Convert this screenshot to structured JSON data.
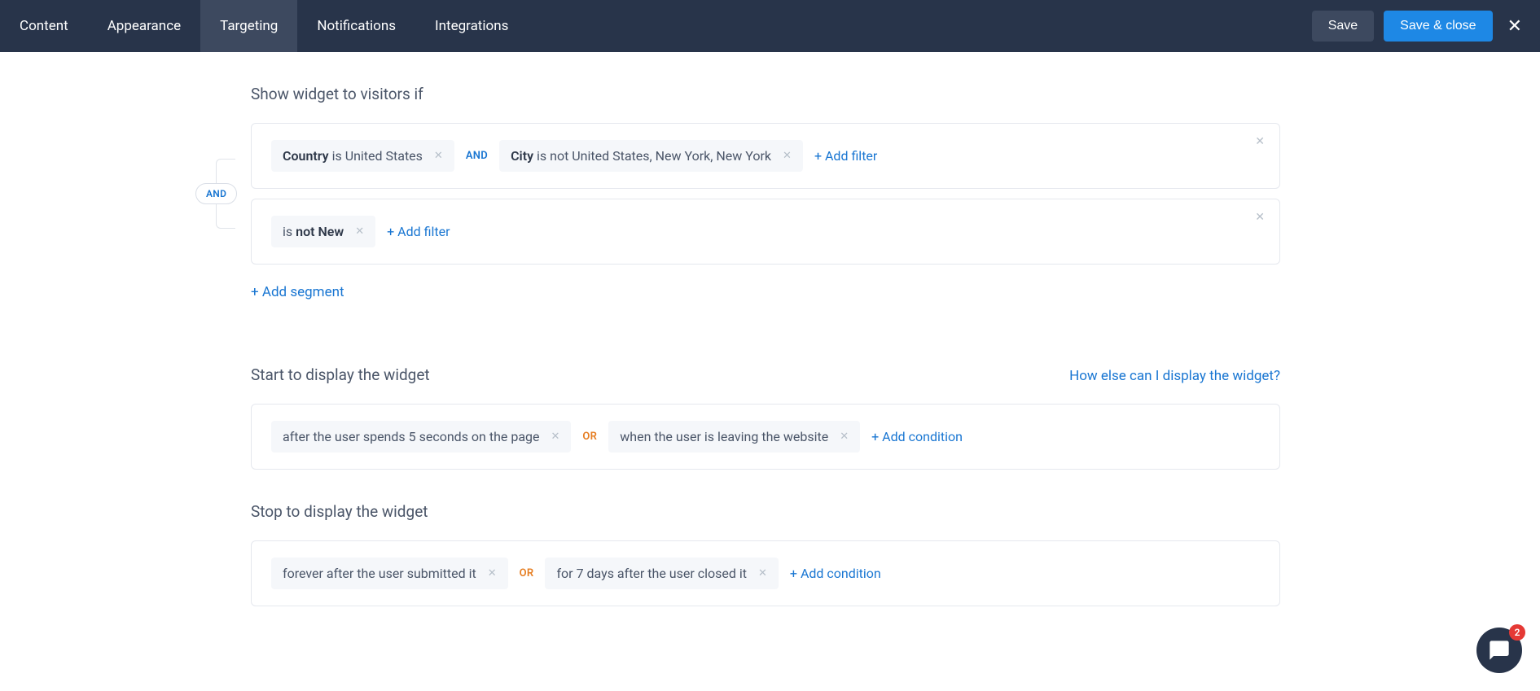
{
  "topbar": {
    "tabs": [
      "Content",
      "Appearance",
      "Targeting",
      "Notifications",
      "Integrations"
    ],
    "active_tab": "Targeting",
    "save_label": "Save",
    "save_close_label": "Save & close"
  },
  "show_widget": {
    "title": "Show widget to visitors if",
    "connector_label": "AND",
    "segments": [
      {
        "filters": [
          {
            "strong": "Country",
            "rest": " is United States"
          },
          {
            "strong": "City",
            "rest": " is not United States, New York, New York"
          }
        ],
        "join": "AND",
        "add_filter_label": "+ Add filter"
      },
      {
        "filters": [
          {
            "prefix": "is ",
            "strong": "not New",
            "rest": ""
          }
        ],
        "join": "",
        "add_filter_label": "+ Add filter"
      }
    ],
    "add_segment_label": "+ Add segment"
  },
  "start_display": {
    "title": "Start to display the widget",
    "help_label": "How else can I display the widget?",
    "conditions": [
      "after the user spends 5 seconds on the page",
      "when the user is leaving the website"
    ],
    "join": "OR",
    "add_label": "+ Add condition"
  },
  "stop_display": {
    "title": "Stop to display the widget",
    "conditions": [
      "forever after the user submitted it",
      "for 7 days after the user closed it"
    ],
    "join": "OR",
    "add_label": "+ Add condition"
  },
  "chat": {
    "badge": "2"
  }
}
